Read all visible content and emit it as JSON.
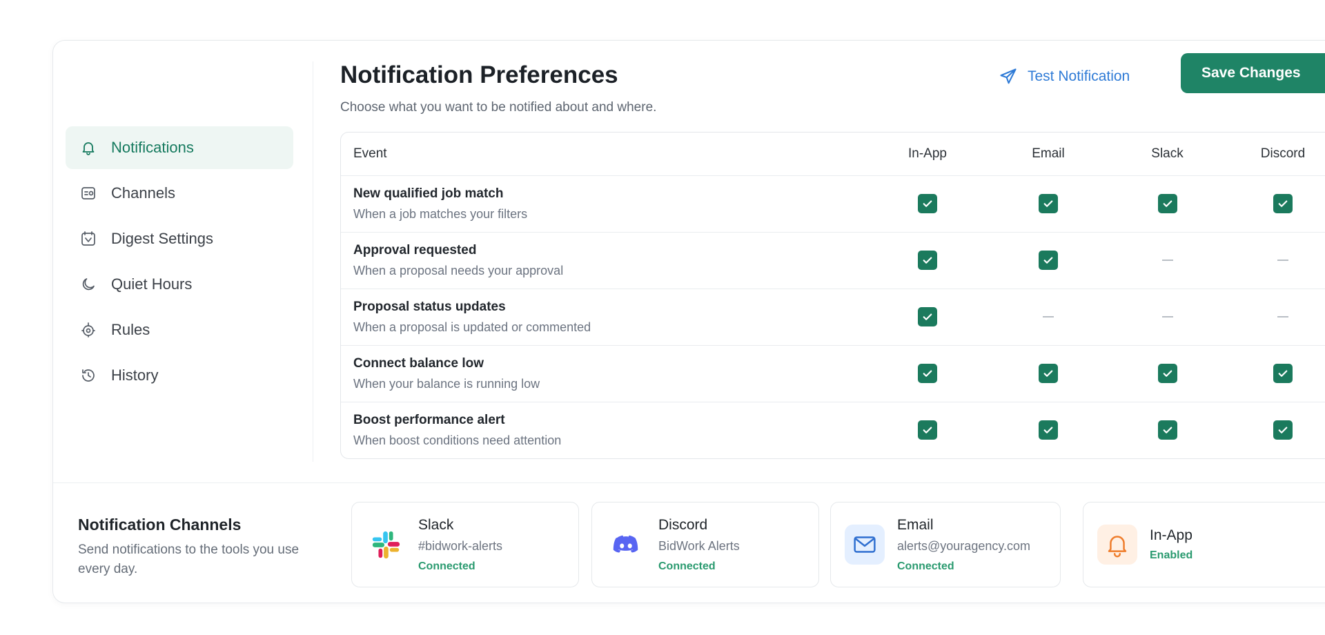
{
  "sidebar": {
    "items": [
      {
        "label": "Notifications",
        "icon": "bell-icon",
        "active": true
      },
      {
        "label": "Channels",
        "icon": "channels-icon",
        "active": false
      },
      {
        "label": "Digest Settings",
        "icon": "digest-icon",
        "active": false
      },
      {
        "label": "Quiet Hours",
        "icon": "moon-icon",
        "active": false
      },
      {
        "label": "Rules",
        "icon": "rules-icon",
        "active": false
      },
      {
        "label": "History",
        "icon": "history-icon",
        "active": false
      }
    ]
  },
  "header": {
    "title": "Notification Preferences",
    "subtitle": "Choose what you want to be notified about and where.",
    "test_label": "Test Notification",
    "save_label": "Save Changes"
  },
  "table": {
    "columns": [
      "Event",
      "In-App",
      "Email",
      "Slack",
      "Discord"
    ],
    "rows": [
      {
        "title": "New qualified job match",
        "desc": "When a job matches your filters",
        "values": [
          true,
          true,
          true,
          true
        ]
      },
      {
        "title": "Approval requested",
        "desc": "When a proposal needs your approval",
        "values": [
          true,
          true,
          false,
          false
        ]
      },
      {
        "title": "Proposal status updates",
        "desc": "When a proposal is updated or commented",
        "values": [
          true,
          false,
          false,
          false
        ]
      },
      {
        "title": "Connect balance low",
        "desc": "When your balance is running low",
        "values": [
          true,
          true,
          true,
          true
        ]
      },
      {
        "title": "Boost performance alert",
        "desc": "When boost conditions need attention",
        "values": [
          true,
          true,
          true,
          true
        ]
      }
    ]
  },
  "channels_section": {
    "title": "Notification Channels",
    "desc": "Send notifications to the tools you use every day.",
    "cards": [
      {
        "name": "Slack",
        "sub": "#bidwork-alerts",
        "status": "Connected",
        "icon": "slack-icon"
      },
      {
        "name": "Discord",
        "sub": "BidWork Alerts",
        "status": "Connected",
        "icon": "discord-icon"
      },
      {
        "name": "Email",
        "sub": "alerts@youragency.com",
        "status": "Connected",
        "icon": "mail-icon"
      },
      {
        "name": "In-App",
        "sub": "",
        "status": "Enabled",
        "icon": "bell-icon"
      }
    ]
  },
  "colors": {
    "accent": "#1f8466",
    "check": "#1b7a5d",
    "link": "#2f7bd6",
    "status_ok": "#2a9a6f"
  }
}
